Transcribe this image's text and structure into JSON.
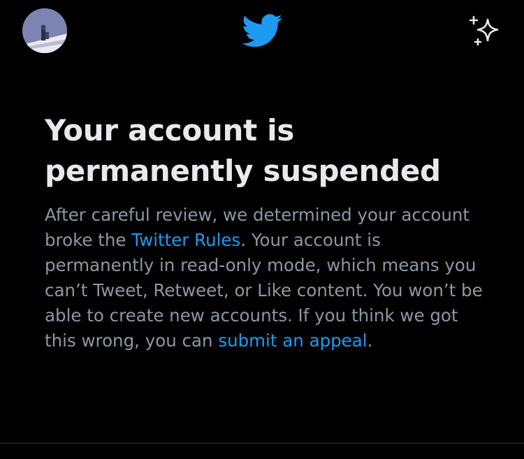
{
  "header": {
    "avatar_icon": "profile-avatar",
    "logo_icon": "twitter-bird-icon",
    "sparkle_icon": "sparkle-icon",
    "brand_color": "#1d9bf0"
  },
  "notice": {
    "title": "Your account is permanently suspended",
    "body_part1": "After careful review, we determined your account broke the ",
    "rules_link": "Twitter Rules",
    "body_part2": ". Your account is permanently in read-only mode, which means you can’t Tweet, Retweet, or Like content. You won’t be able to create new accounts. If you think we got this wrong, you can ",
    "appeal_link": "submit an appeal",
    "body_part3": "."
  },
  "colors": {
    "background": "#000000",
    "title": "#e7e9ea",
    "body": "#8b98a5",
    "link": "#1d9bf0"
  }
}
